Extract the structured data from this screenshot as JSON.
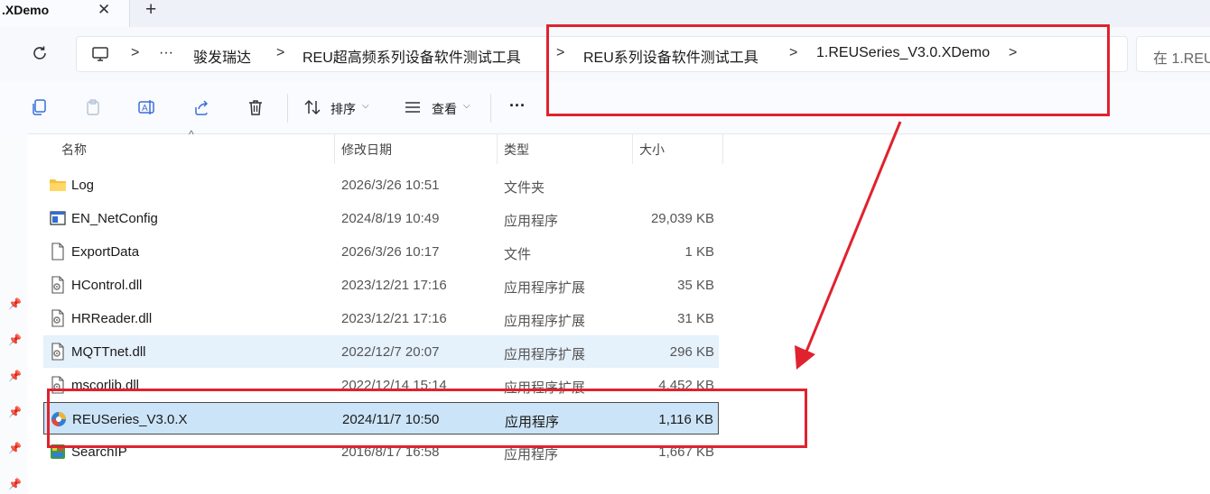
{
  "tab": {
    "title": ".XDemo",
    "close_glyph": "✕",
    "new_glyph": "+"
  },
  "address": {
    "ellipsis": "···",
    "crumbs": [
      "骏发瑞达",
      "REU超高频系列设备软件测试工具",
      "REU系列设备软件测试工具",
      "1.REUSeries_V3.0.XDemo"
    ],
    "separator": ">",
    "search_placeholder": "在 1.REU"
  },
  "toolbar": {
    "sort_label": "排序",
    "view_label": "查看",
    "more_label": "···"
  },
  "columns": {
    "name": "名称",
    "date": "修改日期",
    "type": "类型",
    "size": "大小"
  },
  "files": [
    {
      "name": "Log",
      "date": "2026/3/26 10:51",
      "type": "文件夹",
      "size": "",
      "icon": "folder-icon"
    },
    {
      "name": "EN_NetConfig",
      "date": "2024/8/19 10:49",
      "type": "应用程序",
      "size": "29,039 KB",
      "icon": "app-window-icon"
    },
    {
      "name": "ExportData",
      "date": "2026/3/26 10:17",
      "type": "文件",
      "size": "1 KB",
      "icon": "file-icon"
    },
    {
      "name": "HControl.dll",
      "date": "2023/12/21 17:16",
      "type": "应用程序扩展",
      "size": "35 KB",
      "icon": "dll-icon"
    },
    {
      "name": "HRReader.dll",
      "date": "2023/12/21 17:16",
      "type": "应用程序扩展",
      "size": "31 KB",
      "icon": "dll-icon"
    },
    {
      "name": "MQTTnet.dll",
      "date": "2022/12/7 20:07",
      "type": "应用程序扩展",
      "size": "296 KB",
      "icon": "dll-icon"
    },
    {
      "name": "mscorlib.dll",
      "date": "2022/12/14 15:14",
      "type": "应用程序扩展",
      "size": "4,452 KB",
      "icon": "dll-icon"
    },
    {
      "name": "REUSeries_V3.0.X",
      "date": "2024/11/7 10:50",
      "type": "应用程序",
      "size": "1,116 KB",
      "icon": "reuseries-app-icon"
    },
    {
      "name": "SearchIP",
      "date": "2016/8/17 16:58",
      "type": "应用程序",
      "size": "1,667 KB",
      "icon": "searchip-app-icon"
    }
  ],
  "selected_file": "REUSeries_V3.0.X",
  "hovered_file": "MQTTnet.dll",
  "colors": {
    "annotation_red": "#e0222e",
    "selection_bg": "#cce4f7",
    "hover_bg": "#e5f1fb"
  }
}
